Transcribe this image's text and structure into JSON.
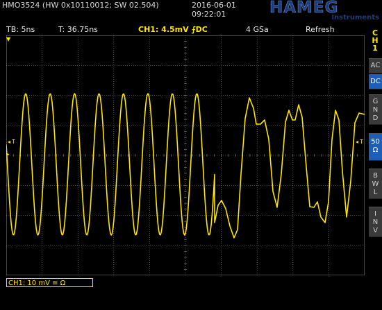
{
  "header": {
    "model": "HMO3524 (HW 0x10110012; SW 02.504)",
    "date": "2016-06-01",
    "time": "09:22:01",
    "logo": "HAMEG",
    "logo_sub": "Instruments"
  },
  "status": {
    "timebase": "TB: 5ns",
    "trigger_time": "T: 36.75ns",
    "channel": "CH1: 4.5mV ⨍DC",
    "sample_rate": "4 GSa",
    "mode": "Refresh"
  },
  "footer": {
    "channel_setting": "CH1: 10 mV ≅ Ω"
  },
  "sidebar": {
    "channel_label": [
      "C",
      "H",
      "1"
    ],
    "buttons": [
      {
        "lines": [
          "AC"
        ],
        "active": false
      },
      {
        "lines": [
          "DC"
        ],
        "active": true
      },
      {
        "lines": [
          "G",
          "N",
          "D"
        ],
        "active": false
      },
      {
        "lines": [
          "50",
          "Ω"
        ],
        "active": true
      },
      {
        "lines": [
          "B",
          "W",
          "L"
        ],
        "active": false
      },
      {
        "lines": [
          "I",
          "N",
          "V"
        ],
        "active": false
      }
    ]
  },
  "markers": {
    "trigger_left": "T",
    "trigger_right": "T",
    "trigger_top": "▼"
  },
  "colors": {
    "trace": "#ffe600",
    "grid": "#8a8a8a",
    "active_button": "#1d5fb8",
    "logo": "#1c3b7a"
  }
}
